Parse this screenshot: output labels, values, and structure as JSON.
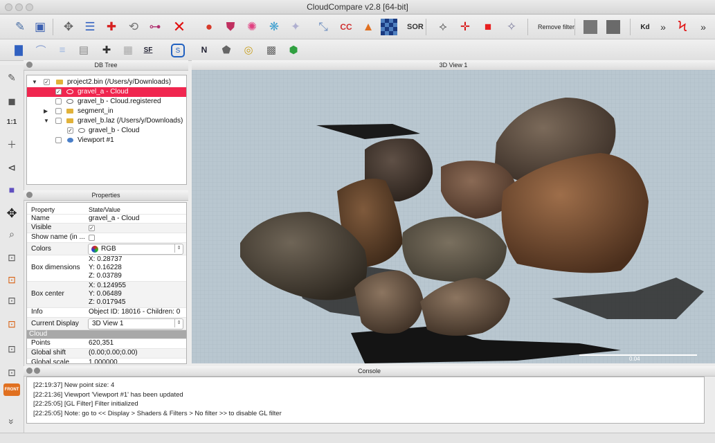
{
  "window": {
    "title": "CloudCompare v2.8 [64-bit]"
  },
  "toolbar1": {
    "remove_filter_label": "Remove filter",
    "kd_label": "Kd",
    "sor_label": "SOR",
    "overflow_label": "»"
  },
  "toolbar2": {
    "sf_label": "SF",
    "normal_label": "N",
    "overflow_label": "»"
  },
  "left_toolbar": {
    "ratio_label": "1:1",
    "front_label": "FRONT",
    "collapse_label": "»"
  },
  "db_tree": {
    "title": "DB Tree",
    "items": [
      {
        "label": "project2.bin (/Users/y/Downloads)",
        "checked": true,
        "expanded": true,
        "type": "folder"
      },
      {
        "label": "gravel_a - Cloud",
        "checked": true,
        "selected": true,
        "type": "cloud"
      },
      {
        "label": "gravel_b - Cloud.registered",
        "checked": false,
        "type": "cloud"
      },
      {
        "label": "segment_in",
        "checked": false,
        "expanded": false,
        "type": "folder"
      },
      {
        "label": "gravel_b.laz (/Users/y/Downloads)",
        "checked": false,
        "expanded": true,
        "type": "folder"
      },
      {
        "label": "gravel_b - Cloud",
        "checked": true,
        "type": "cloud"
      },
      {
        "label": "Viewport #1",
        "checked": false,
        "type": "viewport"
      }
    ]
  },
  "properties": {
    "title": "Properties",
    "header_property": "Property",
    "header_value": "State/Value",
    "name_key": "Name",
    "name_value": "gravel_a - Cloud",
    "visible_key": "Visible",
    "visible_value": "✓",
    "show_name_key": "Show name (in ...",
    "colors_key": "Colors",
    "colors_value": "RGB",
    "box_dim_key": "Box dimensions",
    "box_dim_x": "X: 0.28737",
    "box_dim_y": "Y: 0.16228",
    "box_dim_z": "Z: 0.03789",
    "box_center_key": "Box center",
    "box_center_x": "X: 0.124955",
    "box_center_y": "Y: 0.06489",
    "box_center_z": "Z: 0.017945",
    "info_key": "Info",
    "info_value": "Object ID: 18016 - Children: 0",
    "display_key": "Current Display",
    "display_value": "3D View 1",
    "section_cloud": "Cloud",
    "points_key": "Points",
    "points_value": "620,351",
    "shift_key": "Global shift",
    "shift_value": "(0.00;0.00;0.00)",
    "scale_key": "Global scale",
    "scale_value": "1.000000"
  },
  "view3d": {
    "title": "3D View 1",
    "scale_label": "0.04"
  },
  "console": {
    "title": "Console",
    "lines": [
      "[22:19:37] New point size: 4",
      "[22:21:36] Viewport 'Viewport #1' has been updated",
      "[22:25:05] [GL Filter] Filter initialized",
      "[22:25:05] Note: go to << Display > Shaders & Filters > No filter >> to disable GL filter"
    ]
  },
  "colors": {
    "selection": "#f0264f",
    "rgb_icon_red": "#e02020",
    "grid_bg": "#b8c6cf"
  }
}
